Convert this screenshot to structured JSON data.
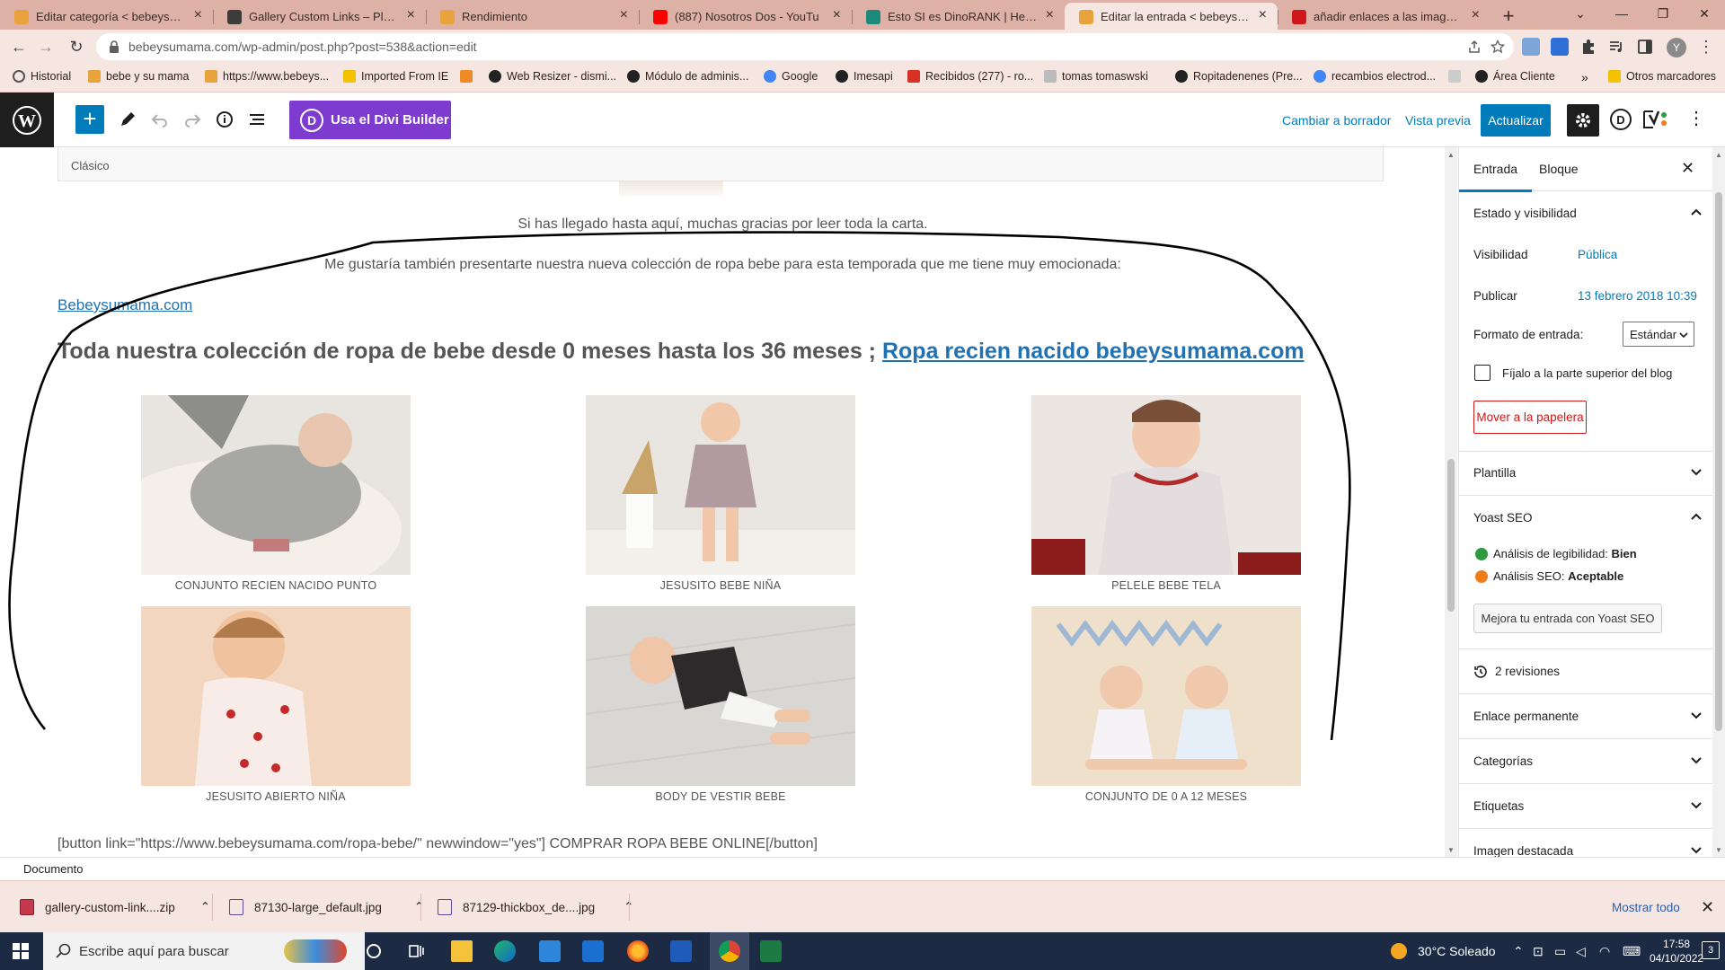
{
  "browser": {
    "tabs": [
      {
        "label": "Editar categoría < bebeysumama",
        "fav": "#e8a33c",
        "active": false
      },
      {
        "label": "Gallery Custom Links – Plugin W",
        "fav": "#3c3c3c",
        "active": false
      },
      {
        "label": "Rendimiento",
        "fav": "#e8a33c",
        "active": false
      },
      {
        "label": "(887) Nosotros Dos - YouTu",
        "fav": "#ff0000",
        "active": false
      },
      {
        "label": "Esto SI es DinoRANK | Herramie",
        "fav": "#1b8a7a",
        "active": false
      },
      {
        "label": "Editar la entrada < bebeysuman",
        "fav": "#e8a33c",
        "active": true
      },
      {
        "label": "añadir enlaces a las imagenes d",
        "fav": "#d0161b",
        "active": false
      }
    ],
    "new_tab": "+",
    "url": "bebeysumama.com/wp-admin/post.php?post=538&action=edit",
    "bookmarks": [
      {
        "label": "Historial",
        "color": "#555"
      },
      {
        "label": "bebe y su mama",
        "color": "#e8a33c"
      },
      {
        "label": "https://www.bebeys...",
        "color": "#e8a33c"
      },
      {
        "label": "Imported From IE",
        "color": "#f2c200"
      },
      {
        "label": "",
        "color": "#f08a24"
      },
      {
        "label": "Web Resizer - dismi...",
        "color": "#222"
      },
      {
        "label": "Módulo de adminis...",
        "color": "#222"
      },
      {
        "label": "Google",
        "color": "#4285f4"
      },
      {
        "label": "Imesapi",
        "color": "#222"
      },
      {
        "label": "Recibidos (277) - ro...",
        "color": "#d93025"
      },
      {
        "label": "tomas tomaswski",
        "color": "#777"
      },
      {
        "label": "Ropitadenenes (Pre...",
        "color": "#222"
      },
      {
        "label": "recambios electrod...",
        "color": "#4285f4"
      },
      {
        "label": "",
        "color": "#aaa"
      },
      {
        "label": "Área Cliente",
        "color": "#222"
      }
    ],
    "bookmarks_more": "»",
    "other_bookmarks": "Otros marcadores"
  },
  "wp_toolbar": {
    "divi_label": "Usa el Divi Builder",
    "divi_letter": "D",
    "switch_draft": "Cambiar a borrador",
    "preview": "Vista previa",
    "update": "Actualizar",
    "d_letter": "D"
  },
  "editor": {
    "classic_label": "Clásico",
    "para1": "Si has llegado hasta aquí, muchas gracias por leer toda la carta.",
    "para2": "Me gustaría también presentarte nuestra nueva colección de ropa bebe para esta temporada que me tiene muy emocionada:",
    "site_link": "Bebeysumama.com",
    "heading_text": "Toda nuestra colección de ropa de bebe desde 0 meses hasta los 36 meses ; ",
    "heading_link": "Ropa recien nacido bebeysumama.com",
    "gallery": [
      {
        "caption": "CONJUNTO RECIEN NACIDO PUNTO"
      },
      {
        "caption": "JESUSITO BEBE NIÑA"
      },
      {
        "caption": "PELELE BEBE TELA"
      },
      {
        "caption": "JESUSITO ABIERTO NIÑA"
      },
      {
        "caption": "BODY DE VESTIR BEBE"
      },
      {
        "caption": "CONJUNTO DE 0 A 12 MESES"
      }
    ],
    "shortcode": "[button link=\"https://www.bebeysumama.com/ropa-bebe/\" newwindow=\"yes\"] COMPRAR ROPA BEBE ONLINE[/button]"
  },
  "sidebar": {
    "tab_post": "Entrada",
    "tab_block": "Bloque",
    "status_title": "Estado y visibilidad",
    "visibility_label": "Visibilidad",
    "visibility_value": "Pública",
    "publish_label": "Publicar",
    "publish_value": "13 febrero 2018 10:39",
    "format_label": "Formato de entrada:",
    "format_value": "Estándar",
    "sticky_label": "Fíjalo a la parte superior del blog",
    "trash": "Mover a la papelera",
    "template": "Plantilla",
    "yoast_title": "Yoast SEO",
    "readability_label": "Análisis de legibilidad:",
    "readability_value": "Bien",
    "seo_label": "Análisis SEO:",
    "seo_value": "Aceptable",
    "yoast_button": "Mejora tu entrada con Yoast SEO",
    "revisions": "2 revisiones",
    "permalink": "Enlace permanente",
    "categories": "Categorías",
    "tags": "Etiquetas",
    "featured": "Imagen destacada"
  },
  "status_bar": {
    "breadcrumb": "Documento"
  },
  "downloads": {
    "items": [
      "gallery-custom-link....zip",
      "87130-large_default.jpg",
      "87129-thickbox_de....jpg"
    ],
    "show_all": "Mostrar todo"
  },
  "taskbar": {
    "search_placeholder": "Escribe aquí para buscar",
    "weather": "30°C  Soleado",
    "time": "17:58",
    "date": "04/10/2022",
    "notifications": "3"
  },
  "colors": {
    "wp_blue": "#007cba",
    "divi_purple": "#7e3bd0",
    "chrome_frame": "#ddb1a6",
    "seo_good": "#2e9a3e",
    "seo_ok": "#ee7c1b"
  }
}
